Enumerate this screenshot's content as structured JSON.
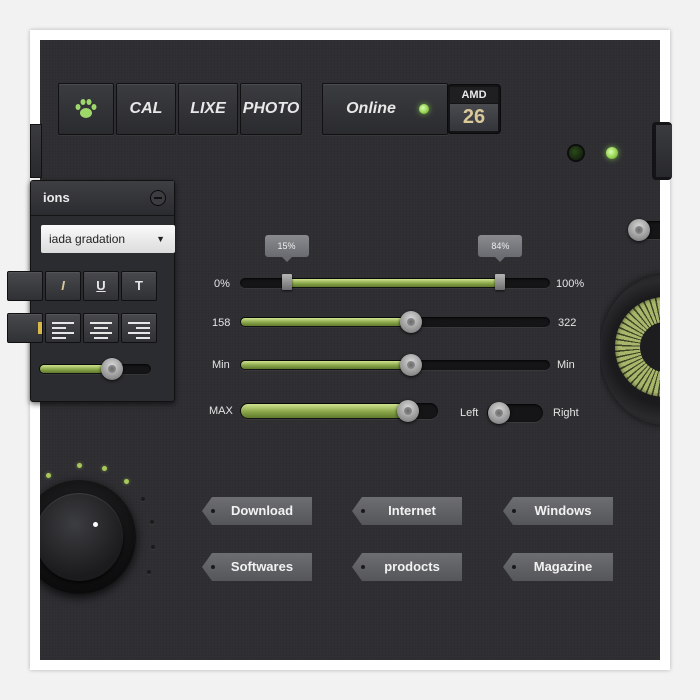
{
  "toolbar": {
    "buttons": [
      {
        "label": "CAL"
      },
      {
        "label": "LIXE"
      },
      {
        "label": "PHOTO"
      }
    ],
    "paw_icon": "paw-icon",
    "online_label": "Online",
    "amd_label": "AMD",
    "amd_value": "26"
  },
  "options_window": {
    "title": "ions",
    "select_value": "iada  gradation",
    "format_buttons": [
      "I",
      "U",
      "T"
    ],
    "align_buttons": [
      "align-left-icon",
      "align-center-icon",
      "align-right-icon"
    ],
    "slider_level": 0.65
  },
  "sliders": {
    "range": {
      "min_label": "0%",
      "max_label": "100%",
      "low_tip": "15%",
      "high_tip": "84%",
      "low": 0.15,
      "high": 0.84
    },
    "value_slider": {
      "min_label": "158",
      "max_label": "322",
      "level": 0.55
    },
    "min_slider": {
      "min_label": "Min",
      "max_label": "Min",
      "level": 0.55
    },
    "max_slider": {
      "label": "MAX",
      "level": 0.85
    },
    "toggle": {
      "left_label": "Left",
      "right_label": "Right"
    }
  },
  "tags": [
    {
      "label": "Download"
    },
    {
      "label": "Internet"
    },
    {
      "label": "Windows"
    },
    {
      "label": "Softwares"
    },
    {
      "label": "prodocts"
    },
    {
      "label": "Magazine"
    }
  ],
  "colors": {
    "accent_green": "#a7c85a",
    "panel_bg": "#2f2f33"
  }
}
